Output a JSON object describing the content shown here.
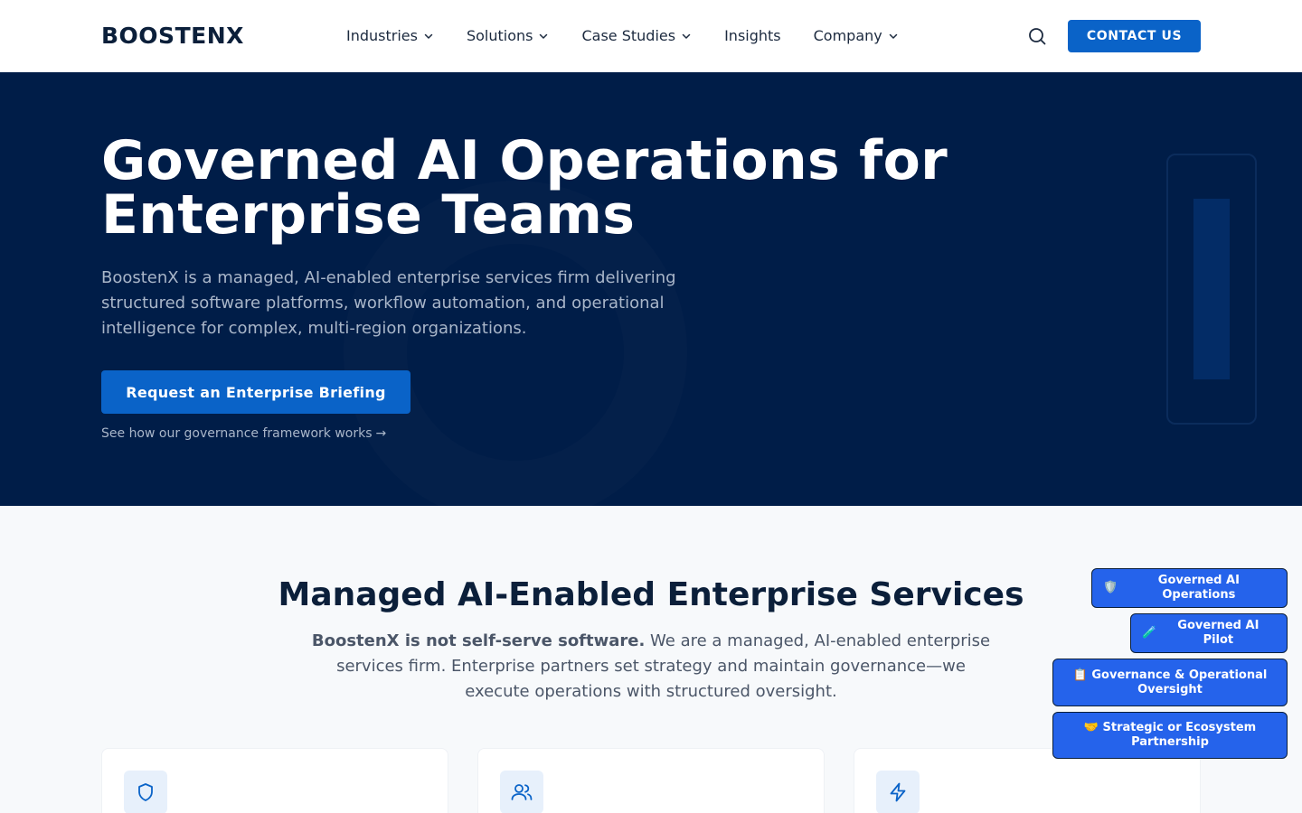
{
  "header": {
    "logo": "BOOSTENX",
    "nav": [
      {
        "label": "Industries",
        "has_dropdown": true
      },
      {
        "label": "Solutions",
        "has_dropdown": true
      },
      {
        "label": "Case Studies",
        "has_dropdown": true
      },
      {
        "label": "Insights",
        "has_dropdown": false
      },
      {
        "label": "Company",
        "has_dropdown": true
      }
    ],
    "search_icon": "search-icon",
    "contact_label": "CONTACT US"
  },
  "hero": {
    "title_line1": "Governed AI Operations for",
    "title_line2": "Enterprise Teams",
    "subtitle": "BoostenX is a managed, AI-enabled enterprise services firm delivering structured software platforms, workflow automation, and operational intelligence for complex, multi-region organizations.",
    "cta_label": "Request an Enterprise Briefing",
    "link_label": "See how our governance framework works",
    "link_arrow": "→"
  },
  "services": {
    "title": "Managed AI-Enabled Enterprise Services",
    "subtitle_bold": "BoostenX is not self-serve software.",
    "subtitle_rest": " We are a managed, AI-enabled enterprise services firm. Enterprise partners set strategy and maintain governance—we execute operations with structured oversight.",
    "cards": [
      {
        "icon": "shield-icon"
      },
      {
        "icon": "users-icon"
      },
      {
        "icon": "lightning-icon"
      }
    ]
  },
  "floating_actions": [
    {
      "emoji": "🛡️",
      "label": "Governed AI Operations"
    },
    {
      "emoji": "🧪",
      "label": "Governed AI Pilot"
    },
    {
      "emoji": "📋",
      "label": "Governance & Operational Oversight"
    },
    {
      "emoji": "🤝",
      "label": "Strategic or Ecosystem Partnership"
    }
  ],
  "colors": {
    "navy": "#001d48",
    "primary_blue": "#0a63c8",
    "fab_blue": "#2563eb",
    "heading": "#0b1f3a"
  }
}
